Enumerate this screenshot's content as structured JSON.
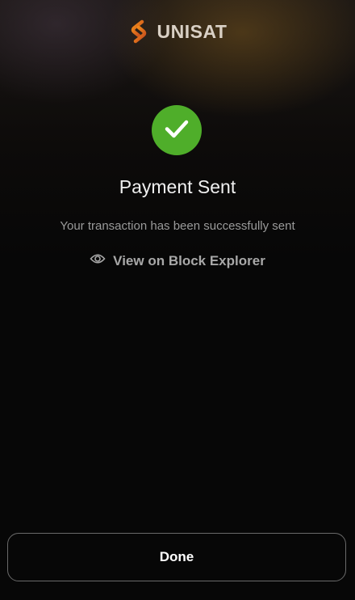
{
  "brand": {
    "name": "UNISAT",
    "logo_icon": "unisat-logo-icon",
    "accent_color": "#f7931a"
  },
  "status": {
    "icon": "checkmark-icon",
    "color": "#4fae2a",
    "title": "Payment Sent",
    "message": "Your transaction has been successfully sent"
  },
  "explorer_link": {
    "icon": "eye-icon",
    "label": "View on Block Explorer"
  },
  "done_button": {
    "label": "Done"
  }
}
